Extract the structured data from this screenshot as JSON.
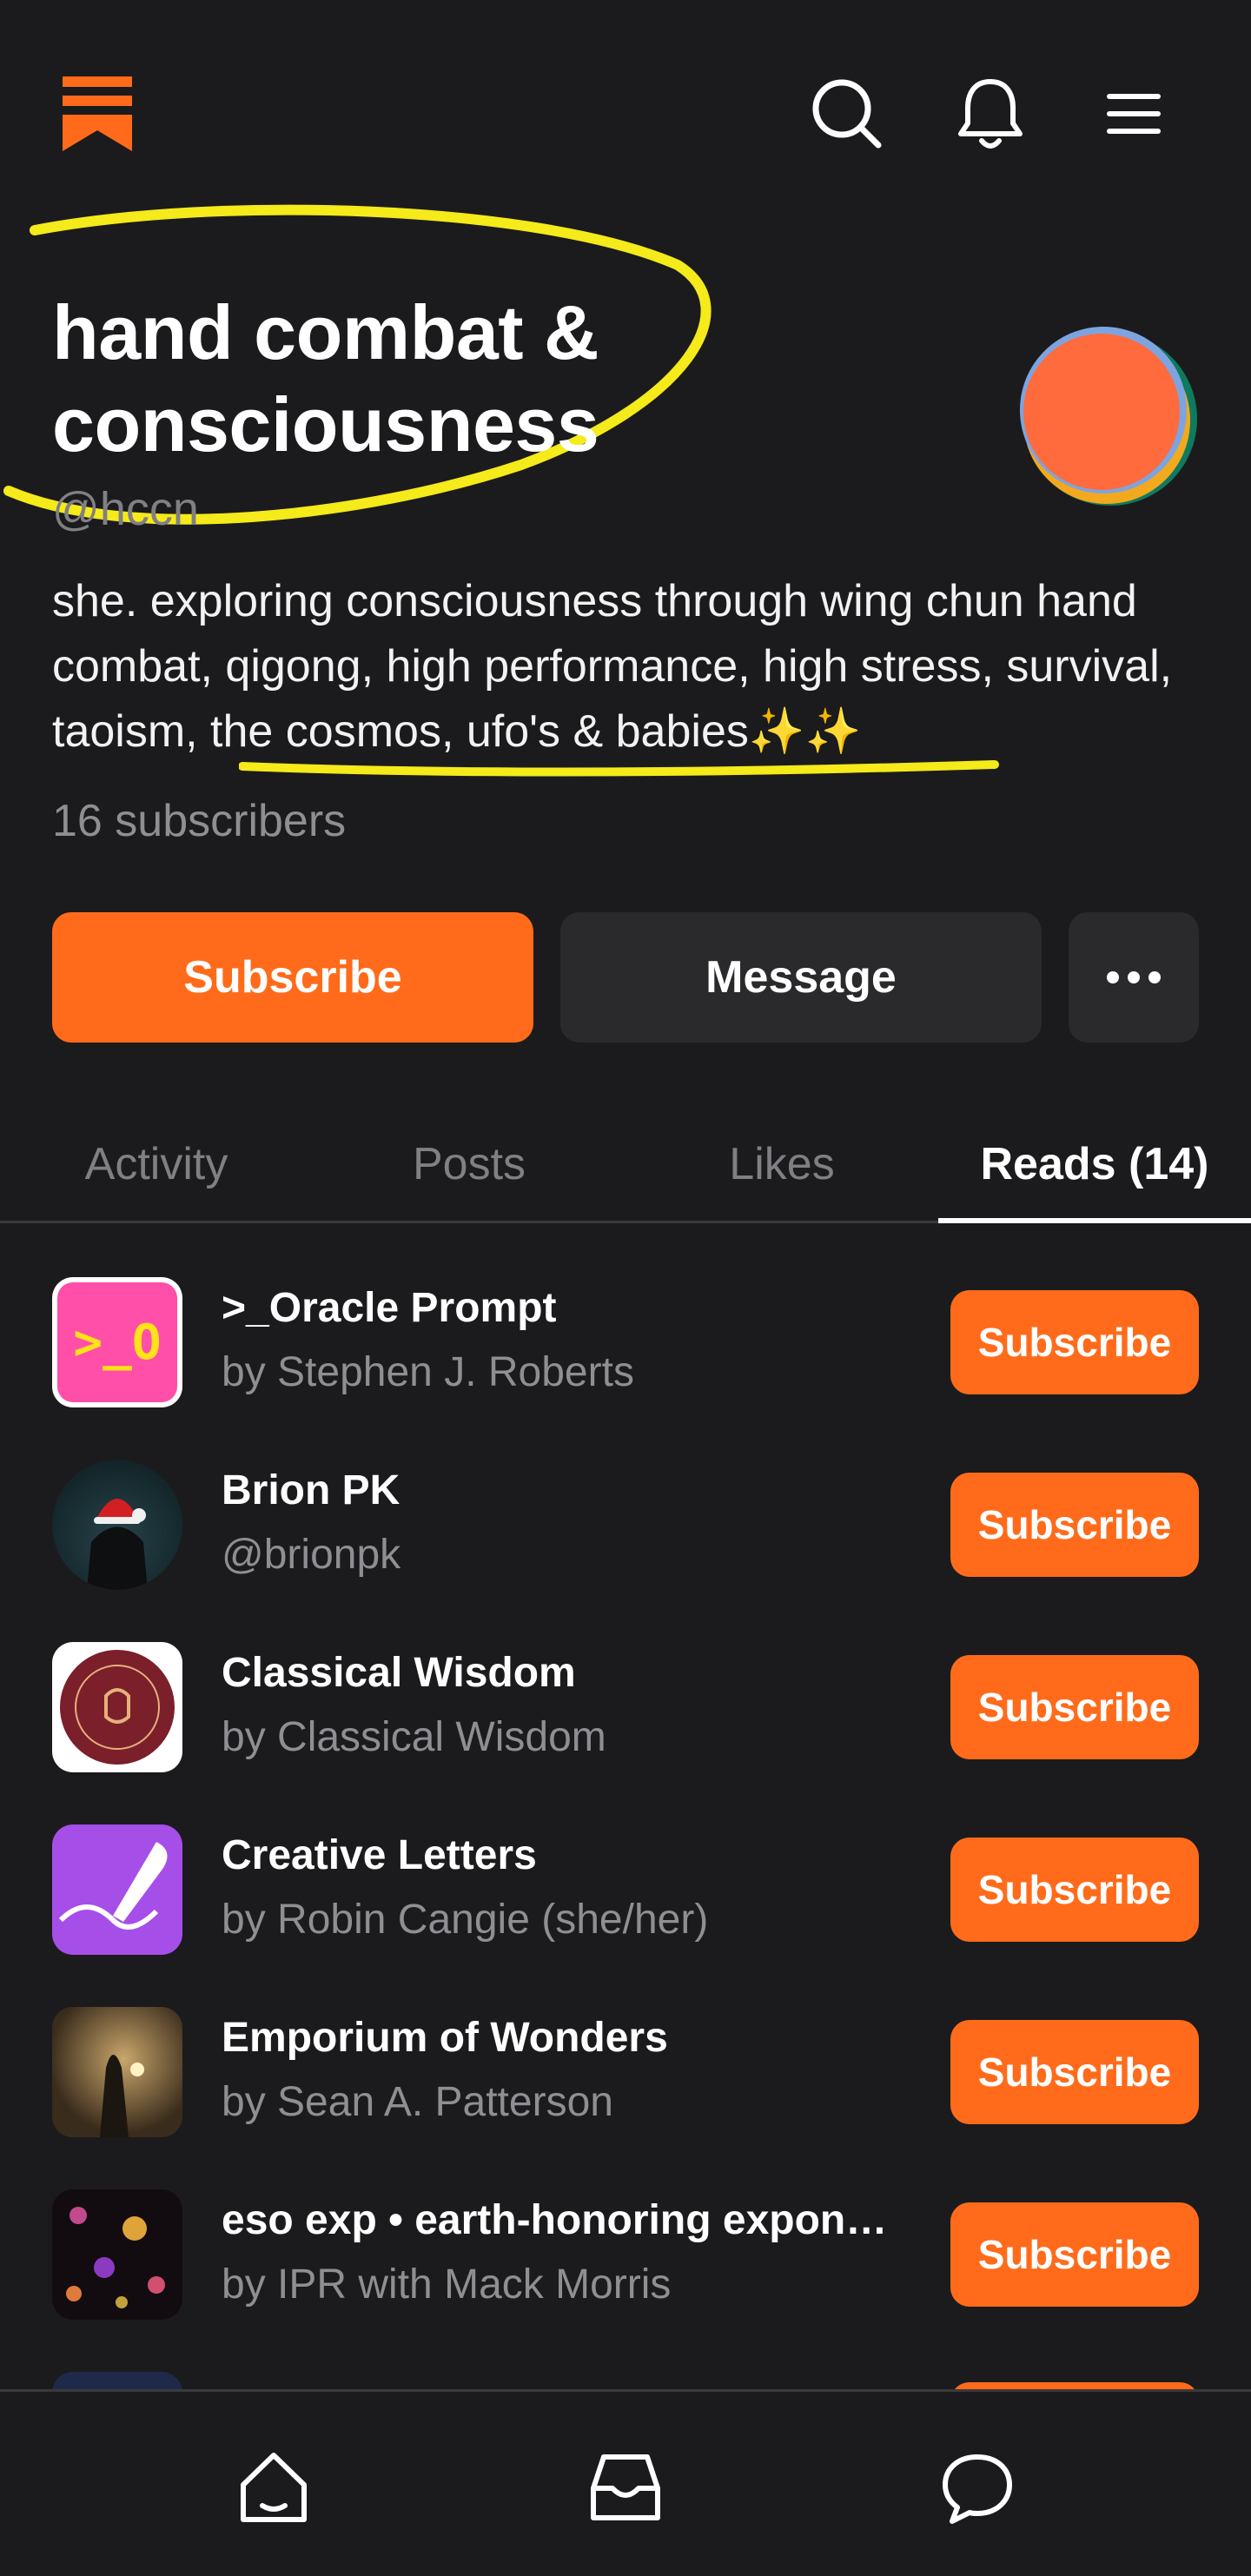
{
  "header": {
    "logo_icon": "substack-logo-icon",
    "search_icon": "search-icon",
    "notifications_icon": "bell-icon",
    "menu_icon": "hamburger-menu-icon"
  },
  "profile": {
    "name_line1": "hand combat &",
    "name_line2": "consciousness",
    "handle": "@hccn",
    "bio": "she. exploring consciousness through wing chun hand combat, qigong, high performance, high stress, survival, taoism, the cosmos, ufo's & babies✨✨",
    "subscribers": "16 subscribers",
    "accent_color": "#ff6b1a",
    "highlight_color": "#f5ea1a"
  },
  "actions": {
    "subscribe_label": "Subscribe",
    "message_label": "Message",
    "more_icon": "more-horizontal-icon"
  },
  "tabs": [
    {
      "label": "Activity",
      "active": false
    },
    {
      "label": "Posts",
      "active": false
    },
    {
      "label": "Likes",
      "active": false
    },
    {
      "label": "Reads (14)",
      "active": true
    }
  ],
  "reads": [
    {
      "title": ">_Oracle Prompt",
      "subtitle": "by Stephen J. Roberts",
      "button": "Subscribe",
      "thumb_text": ">_O"
    },
    {
      "title": "Brion PK",
      "subtitle": "@brionpk",
      "button": "Subscribe"
    },
    {
      "title": "Classical Wisdom",
      "subtitle": "by Classical Wisdom",
      "button": "Subscribe"
    },
    {
      "title": "Creative Letters",
      "subtitle": "by Robin Cangie (she/her)",
      "button": "Subscribe"
    },
    {
      "title": "Emporium of Wonders",
      "subtitle": "by Sean A. Patterson",
      "button": "Subscribe"
    },
    {
      "title": "eso exp • earth-honoring exponent...",
      "subtitle": "by IPR with Mack Morris",
      "button": "Subscribe"
    }
  ],
  "bottom_nav": {
    "home_icon": "home-icon",
    "inbox_icon": "inbox-icon",
    "chat_icon": "chat-bubble-icon"
  }
}
